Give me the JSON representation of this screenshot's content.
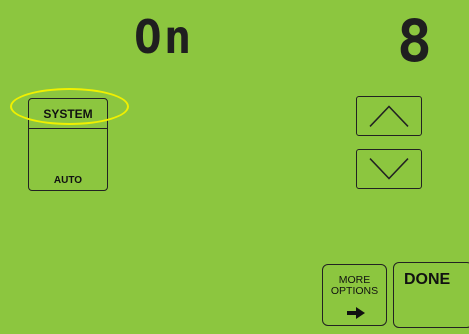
{
  "display": {
    "status": "On",
    "number": "8"
  },
  "system_button": {
    "label": "SYSTEM",
    "mode": "AUTO"
  },
  "buttons": {
    "more_options": "MORE OPTIONS",
    "done": "DONE"
  },
  "icons": {
    "up": "chevron-up-icon",
    "down": "chevron-down-icon",
    "more_arrow": "right-arrow-icon"
  },
  "colors": {
    "background": "#8cc63f",
    "highlight": "#f0f000",
    "ink": "#1f1f1f"
  }
}
